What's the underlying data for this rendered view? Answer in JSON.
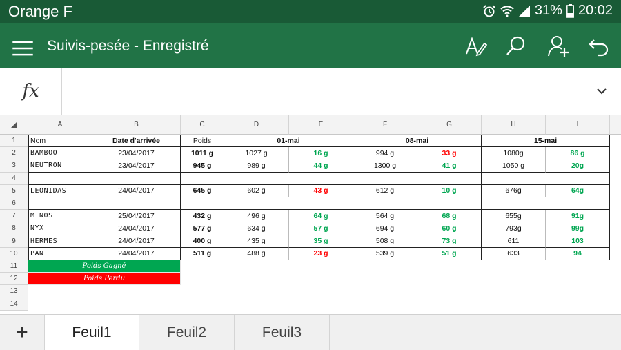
{
  "status": {
    "carrier": "Orange F",
    "battery": "31%",
    "time": "20:02"
  },
  "app": {
    "title": "Suivis-pesée - Enregistré"
  },
  "formula": {
    "symbol": "fx",
    "value": ""
  },
  "columns": [
    "A",
    "B",
    "C",
    "D",
    "E",
    "F",
    "G",
    "H",
    "I"
  ],
  "rows": [
    "1",
    "2",
    "3",
    "4",
    "5",
    "6",
    "7",
    "8",
    "9",
    "10",
    "11",
    "12",
    "13",
    "14"
  ],
  "header_row": {
    "nom": "Nom",
    "date": "Date d'arrivée",
    "poids": "Poids",
    "d1": "01-mai",
    "d2": "08-mai",
    "d3": "15-mai"
  },
  "animals": [
    {
      "row": 2,
      "name": "BAMBOO",
      "date": "23/04/2017",
      "poids": "1011 g",
      "w1": "1027 g",
      "g1": "16 g",
      "w2": "994 g",
      "g2": "33 g",
      "w3": "1080g",
      "g3": "86 g",
      "c1": "green",
      "c2": "red",
      "c3": "green"
    },
    {
      "row": 3,
      "name": "NEUTRON",
      "date": "23/04/2017",
      "poids": "945 g",
      "w1": "989 g",
      "g1": "44 g",
      "w2": "1300 g",
      "g2": "41 g",
      "w3": "1050 g",
      "g3": "20g",
      "c1": "green",
      "c2": "green",
      "c3": "green"
    },
    {
      "row": 5,
      "name": "LEONIDAS",
      "date": "24/04/2017",
      "poids": "645 g",
      "w1": "602 g",
      "g1": "43 g",
      "w2": "612 g",
      "g2": "10 g",
      "w3": "676g",
      "g3": "64g",
      "c1": "red",
      "c2": "green",
      "c3": "green"
    },
    {
      "row": 7,
      "name": "MINOS",
      "date": "25/04/2017",
      "poids": "432 g",
      "w1": "496 g",
      "g1": "64 g",
      "w2": "564 g",
      "g2": "68 g",
      "w3": "655g",
      "g3": "91g",
      "c1": "green",
      "c2": "green",
      "c3": "green"
    },
    {
      "row": 8,
      "name": "NYX",
      "date": "24/04/2017",
      "poids": "577 g",
      "w1": "634 g",
      "g1": "57 g",
      "w2": "694 g",
      "g2": "60 g",
      "w3": "793g",
      "g3": "99g",
      "c1": "green",
      "c2": "green",
      "c3": "green"
    },
    {
      "row": 9,
      "name": "HERMES",
      "date": "24/04/2017",
      "poids": "400 g",
      "w1": "435 g",
      "g1": "35 g",
      "w2": "508 g",
      "g2": "73 g",
      "w3": "611",
      "g3": "103",
      "c1": "green",
      "c2": "green",
      "c3": "green"
    },
    {
      "row": 10,
      "name": "PAN",
      "date": "24/04/2017",
      "poids": "511 g",
      "w1": "488 g",
      "g1": "23 g",
      "w2": "539 g",
      "g2": "51 g",
      "w3": "633",
      "g3": "94",
      "c1": "red",
      "c2": "green",
      "c3": "green"
    }
  ],
  "legend": {
    "gain": "Poids Gagné",
    "loss": "Poids Perdu"
  },
  "sheets": {
    "add": "+",
    "tabs": [
      "Feuil1",
      "Feuil2",
      "Feuil3"
    ]
  },
  "colors": {
    "green": "#00a651",
    "red": "#ff0000",
    "brand": "#217346"
  }
}
